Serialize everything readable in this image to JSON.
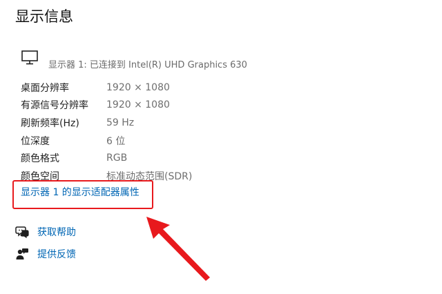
{
  "title": "显示信息",
  "display": {
    "icon": "monitor-icon",
    "label": "显示器 1: 已连接到 Intel(R) UHD Graphics 630"
  },
  "rows": [
    {
      "label": "桌面分辨率",
      "value": "1920 × 1080"
    },
    {
      "label": "有源信号分辨率",
      "value": "1920 × 1080"
    },
    {
      "label": "刷新频率(Hz)",
      "value": "59 Hz"
    },
    {
      "label": "位深度",
      "value": "6 位"
    },
    {
      "label": "颜色格式",
      "value": "RGB"
    },
    {
      "label": "颜色空间",
      "value": "标准动态范围(SDR)"
    }
  ],
  "adapter_link": "显示器 1 的显示适配器属性",
  "help": {
    "get_help": {
      "label": "获取帮助",
      "icon": "chat-help-icon"
    },
    "feedback": {
      "label": "提供反馈",
      "icon": "feedback-person-icon"
    }
  },
  "colors": {
    "link": "#0066b4",
    "annotation": "#e8191d"
  }
}
